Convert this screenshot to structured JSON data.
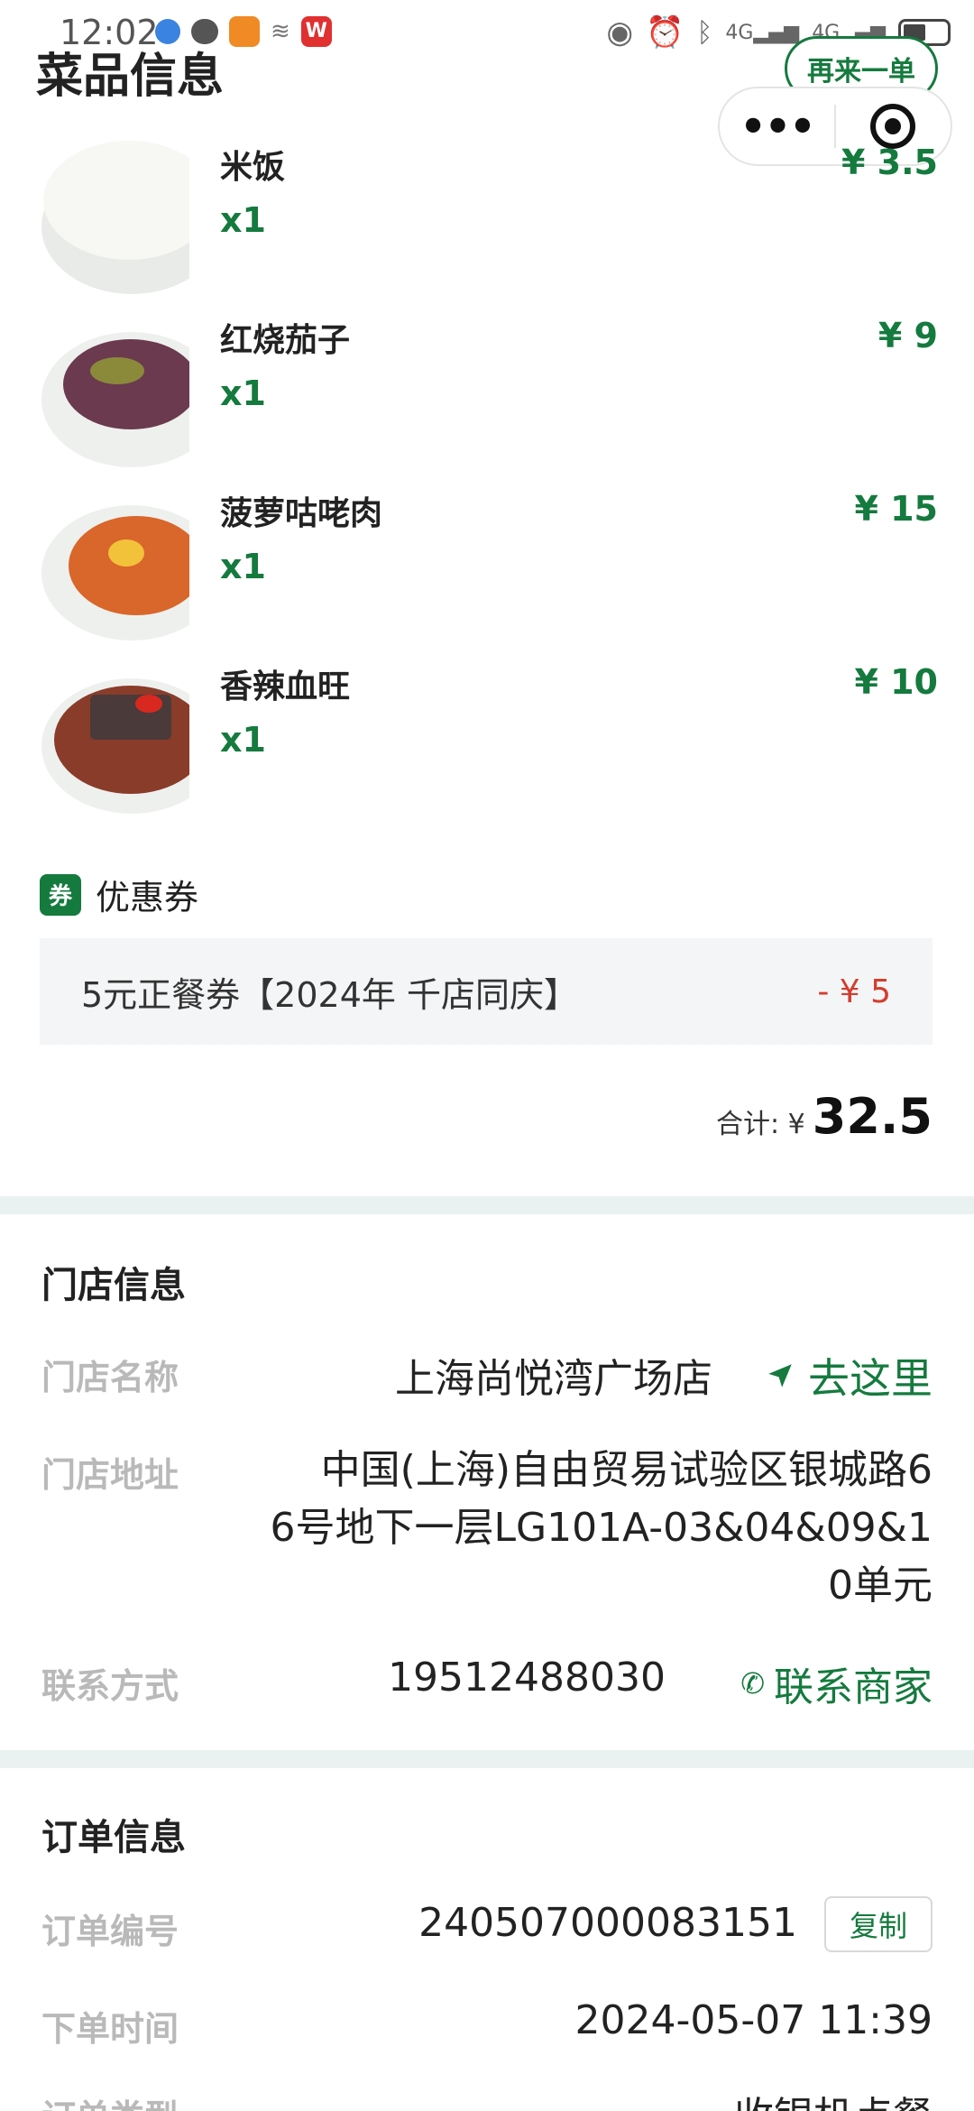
{
  "status_bar": {
    "time": "12:02",
    "network": "4G"
  },
  "header": {
    "title": "菜品信息",
    "reorder_label": "再来一单",
    "more_label": "•••"
  },
  "dishes": [
    {
      "name": "米饭",
      "qty": "x1",
      "price": "¥ 3.5"
    },
    {
      "name": "红烧茄子",
      "qty": "x1",
      "price": "¥ 9"
    },
    {
      "name": "菠萝咕咾肉",
      "qty": "x1",
      "price": "¥ 15"
    },
    {
      "name": "香辣血旺",
      "qty": "x1",
      "price": "¥ 10"
    }
  ],
  "coupon": {
    "tag": "券",
    "title": "优惠券",
    "name": "5元正餐券【2024年 千店同庆】",
    "value": "- ¥ 5"
  },
  "total": {
    "label": "合计: ¥",
    "value": "32.5"
  },
  "store": {
    "title": "门店信息",
    "name_label": "门店名称",
    "name": "上海尚悦湾广场店",
    "navigate_label": "去这里",
    "address_label": "门店地址",
    "address_line1": "中国(上海)自由贸易试验区银城路6",
    "address_line2": "6号地下一层LG101A-03&04&09&1",
    "address_line3": "0单元",
    "contact_label": "联系方式",
    "phone": "19512488030",
    "contact_link": "联系商家"
  },
  "order": {
    "title": "订单信息",
    "number_label": "订单编号",
    "number": "240507000083151",
    "copy_label": "复制",
    "time_label": "下单时间",
    "time": "2024-05-07 11:39",
    "type_label": "订单类型",
    "type": "收银机点餐"
  },
  "colors": {
    "accent": "#157a3e",
    "discount": "#d43d2e",
    "divider": "#eaf1f1"
  }
}
